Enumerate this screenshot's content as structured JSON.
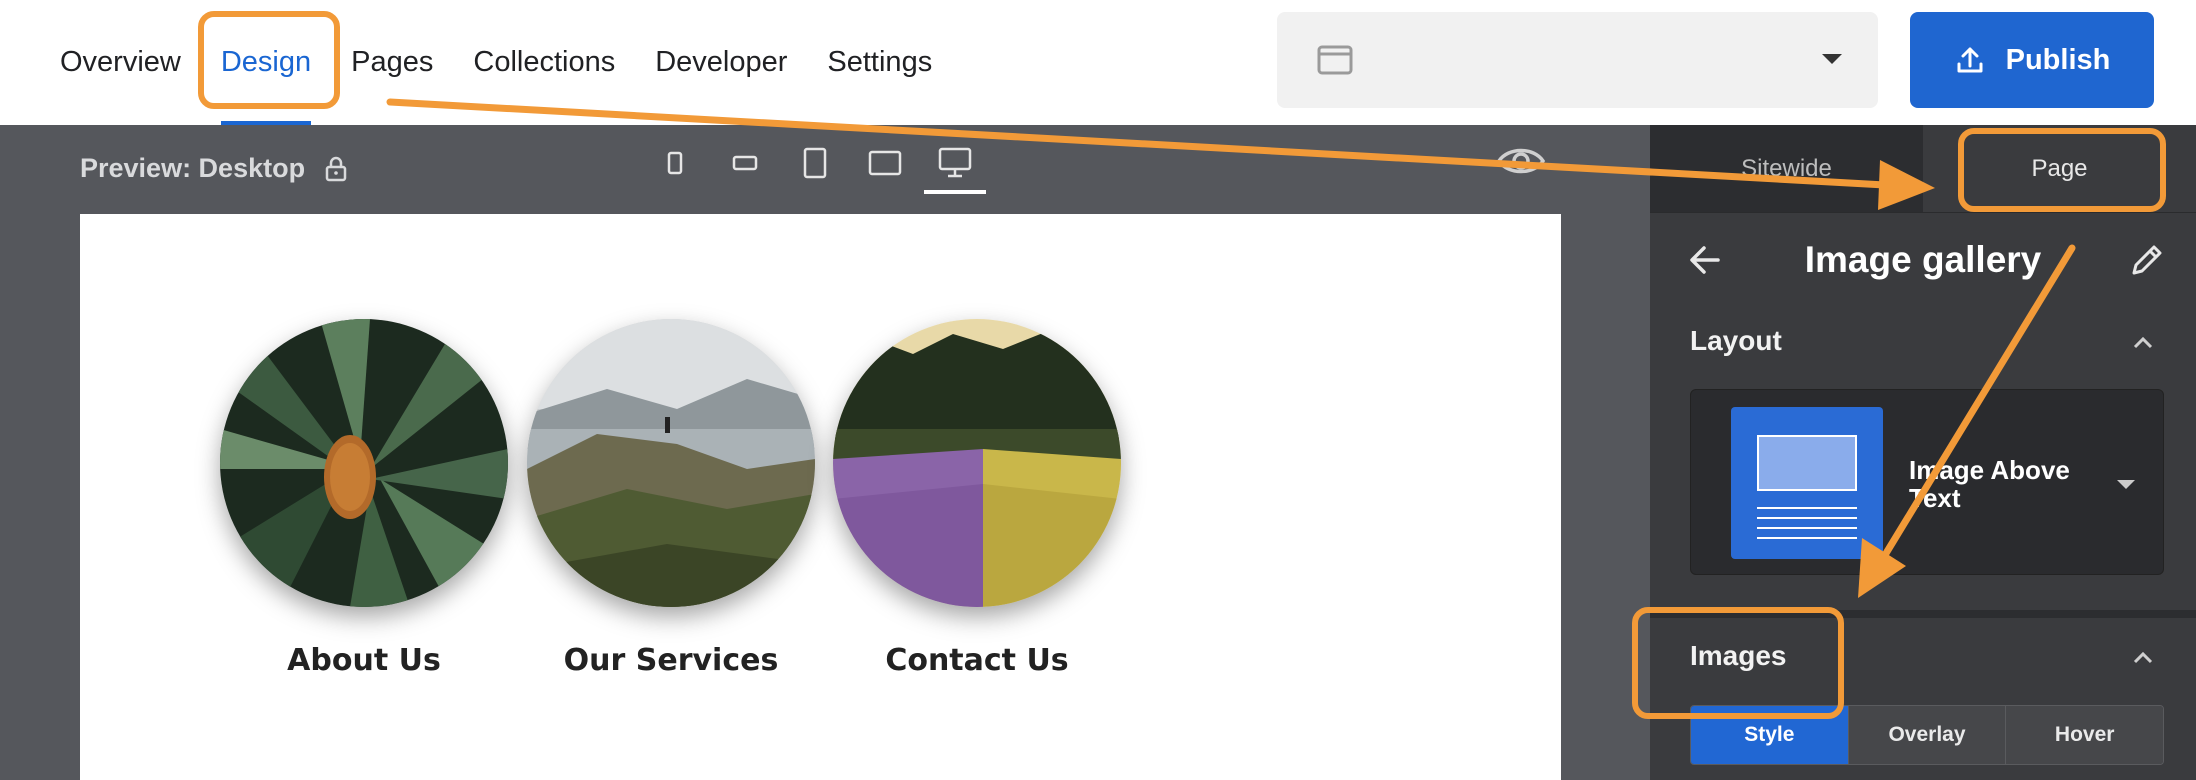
{
  "nav": {
    "items": [
      {
        "label": "Overview",
        "active": false
      },
      {
        "label": "Design",
        "active": true
      },
      {
        "label": "Pages",
        "active": false
      },
      {
        "label": "Collections",
        "active": false
      },
      {
        "label": "Developer",
        "active": false
      },
      {
        "label": "Settings",
        "active": false
      }
    ]
  },
  "site_select": {
    "value": ""
  },
  "publish": {
    "label": "Publish"
  },
  "preview": {
    "label": "Preview: Desktop"
  },
  "devices": [
    "phone-portrait-icon",
    "phone-landscape-icon",
    "tablet-portrait-icon",
    "tablet-landscape-icon",
    "desktop-icon"
  ],
  "canvas": {
    "items": [
      {
        "caption": "About Us"
      },
      {
        "caption": "Our Services"
      },
      {
        "caption": "Contact Us"
      }
    ]
  },
  "panel": {
    "tabs": [
      {
        "label": "Sitewide",
        "active": false
      },
      {
        "label": "Page",
        "active": true
      }
    ],
    "title": "Image gallery",
    "layout_section": "Layout",
    "layout_value": "Image Above Text",
    "images_section": "Images",
    "segments": [
      {
        "label": "Style",
        "active": true
      },
      {
        "label": "Overlay",
        "active": false
      },
      {
        "label": "Hover",
        "active": false
      }
    ]
  },
  "colors": {
    "accent": "#1f66d0",
    "annotation": "#f29a38",
    "workspace": "#55575c",
    "panel": "#3a3b3e"
  }
}
